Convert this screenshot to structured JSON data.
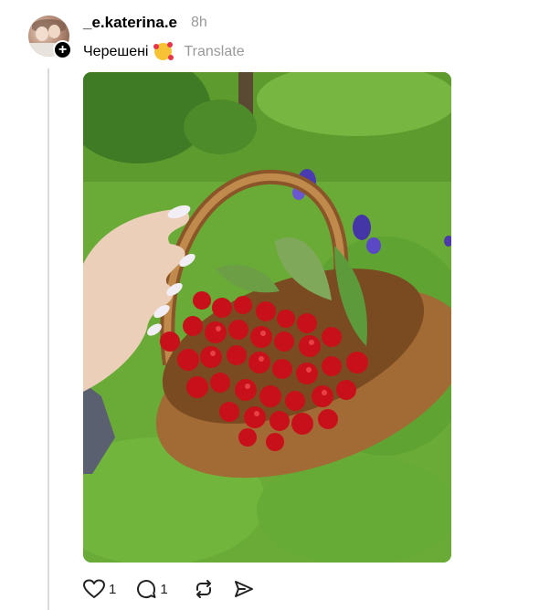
{
  "post": {
    "username": "_e.katerina.e",
    "time": "8h",
    "caption": "Черешені",
    "emoji_icon": "smiling-face-with-hearts",
    "translate_label": "Translate"
  },
  "actions": {
    "likes": "1",
    "replies": "1"
  },
  "photo": {
    "subject": "hand-holding-wicker-basket-of-cherries",
    "colors": {
      "grass": "#6fb23a",
      "cherry": "#c8101b",
      "wicker": "#b27a3e",
      "iris": "#4b3aa8"
    }
  }
}
